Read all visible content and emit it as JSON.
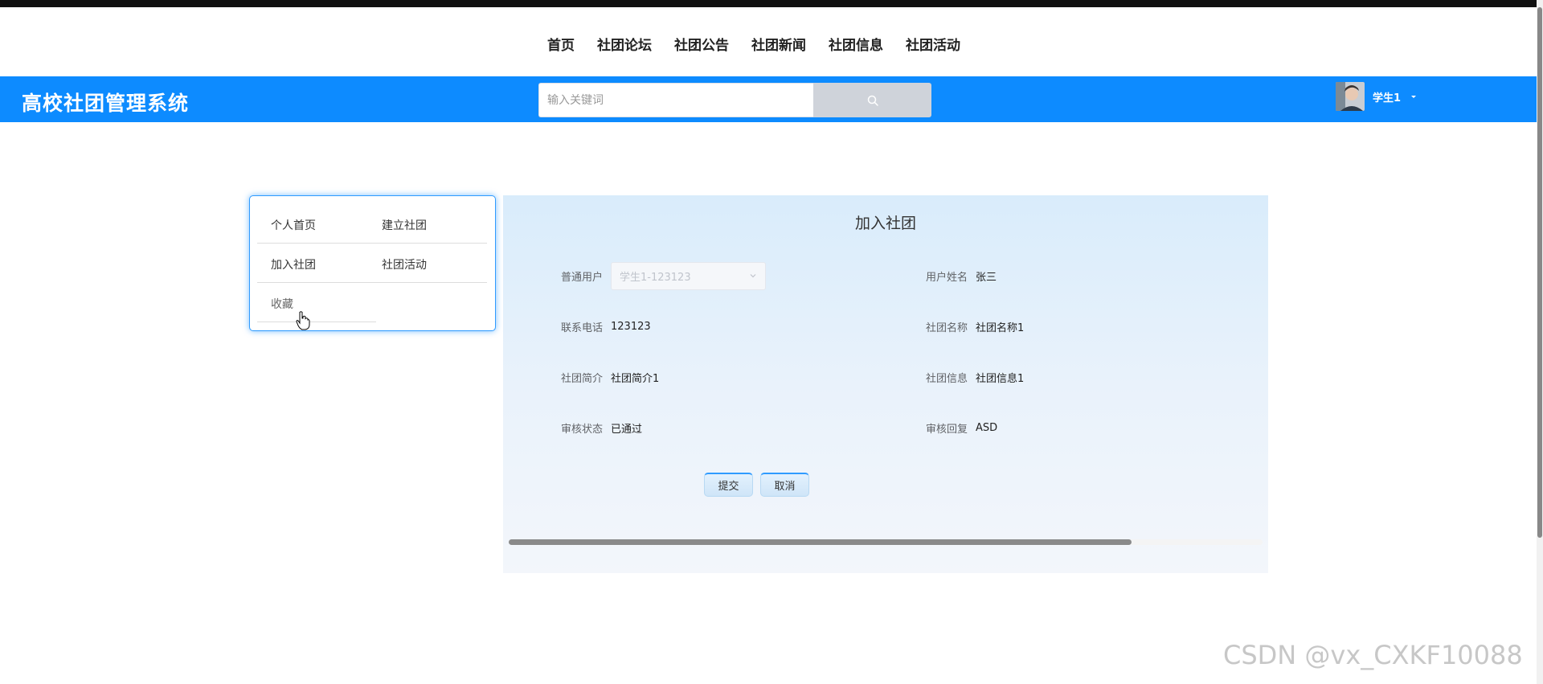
{
  "nav": {
    "items": [
      "首页",
      "社团论坛",
      "社团公告",
      "社团新闻",
      "社团信息",
      "社团活动"
    ]
  },
  "header": {
    "brand": "高校社团管理系统",
    "search_placeholder": "输入关键词",
    "search_icon": "search-icon",
    "user_name": "学生1",
    "accent_color": "#0d8bff"
  },
  "sidebar": {
    "items": [
      "个人首页",
      "建立社团",
      "加入社团",
      "社团活动",
      "收藏"
    ]
  },
  "form": {
    "title": "加入社团",
    "user_label": "普通用户",
    "user_select_value": "学生1-123123",
    "name_label": "用户姓名",
    "name_value": "张三",
    "phone_label": "联系电话",
    "phone_value": "123123",
    "club_name_label": "社团名称",
    "club_name_value": "社团名称1",
    "club_intro_label": "社团简介",
    "club_intro_value": "社团简介1",
    "club_info_label": "社团信息",
    "club_info_value": "社团信息1",
    "status_label": "审核状态",
    "status_value": "已通过",
    "reply_label": "审核回复",
    "reply_value": "ASD",
    "submit_label": "提交",
    "cancel_label": "取消"
  },
  "watermark": "CSDN @vx_CXKF10088"
}
